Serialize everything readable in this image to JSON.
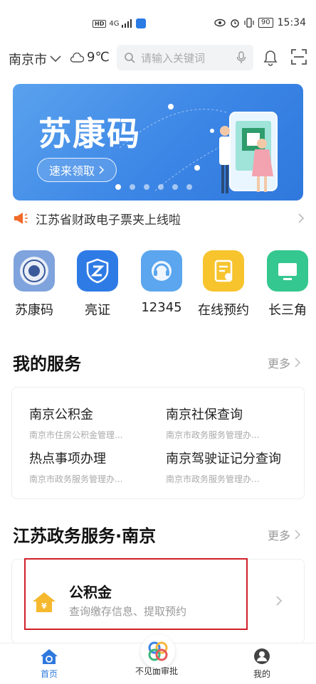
{
  "status_bar": {
    "network": "4G",
    "battery": "90",
    "time": "15:34"
  },
  "header": {
    "city": "南京市",
    "temperature": "9℃",
    "search_placeholder": "请输入关键词"
  },
  "banner": {
    "title": "苏康码",
    "cta": "速来领取",
    "slide_count": 6,
    "active_slide": 1
  },
  "notice": {
    "text": "江苏省财政电子票夹上线啦"
  },
  "apps": [
    {
      "label": "苏康码",
      "icon": "emblem-icon",
      "color": "#6f99d8"
    },
    {
      "label": "亮证",
      "icon": "shield-z-icon",
      "color": "#2f7be6"
    },
    {
      "label": "12345",
      "icon": "headset-icon",
      "color": "#5ba6ee"
    },
    {
      "label": "在线预约",
      "icon": "calendar-icon",
      "color": "#f7c42e"
    },
    {
      "label": "长三角",
      "icon": "monitor-icon",
      "color": "#34c78f"
    }
  ],
  "my_services": {
    "title": "我的服务",
    "more": "更多",
    "items": [
      {
        "name": "南京公积金",
        "sub": "南京市住房公积金管理..."
      },
      {
        "name": "南京社保查询",
        "sub": "南京市政务服务管理办..."
      },
      {
        "name": "热点事项办理",
        "sub": "南京市政务服务管理办..."
      },
      {
        "name": "南京驾驶证记分查询",
        "sub": "南京市政务服务管理办..."
      }
    ]
  },
  "gov_services": {
    "title": "江苏政务服务·南京",
    "more": "更多",
    "card": {
      "name": "公积金",
      "sub": "查询缴存信息、提取预约",
      "icon": "house-yuan-icon"
    }
  },
  "bottom_nav": {
    "items": [
      {
        "label": "首页",
        "icon": "home-icon",
        "active": true
      },
      {
        "label": "不见面审批",
        "icon": "approval-logo-icon",
        "active": false
      },
      {
        "label": "我的",
        "icon": "user-icon",
        "active": false
      }
    ]
  },
  "colors": {
    "primary": "#2f78dd",
    "highlight_border": "#d0202a",
    "notice_icon": "#f06a2a"
  }
}
